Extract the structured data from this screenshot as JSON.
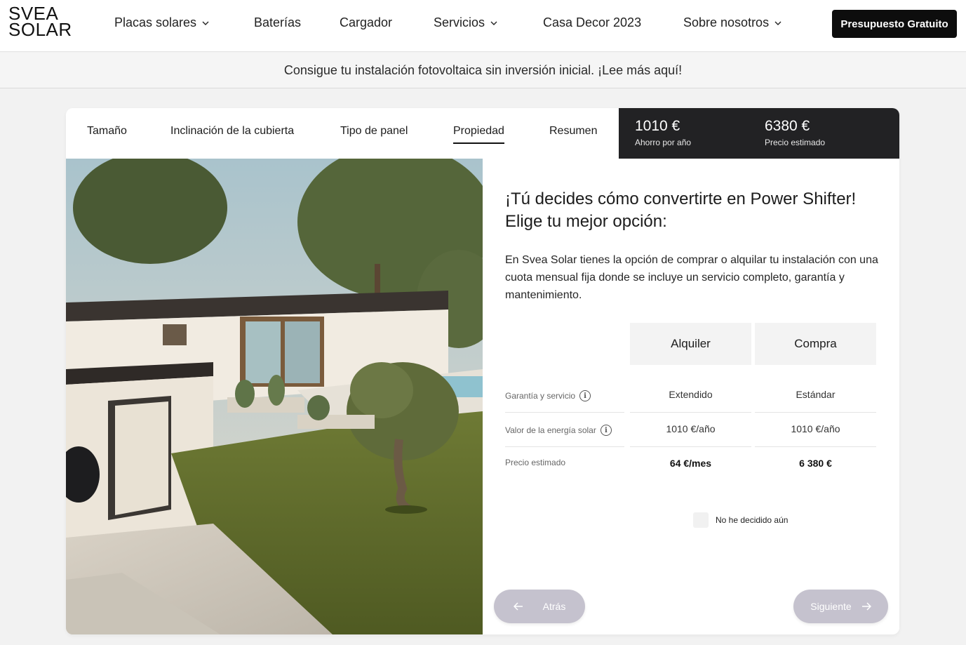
{
  "header": {
    "logo_line1": "SVEA",
    "logo_line2": "SOLAR",
    "nav": [
      {
        "label": "Placas solares",
        "icon": "chevron-down-icon"
      },
      {
        "label": "Baterías"
      },
      {
        "label": "Cargador"
      },
      {
        "label": "Servicios",
        "icon": "chevron-down-icon"
      },
      {
        "label": "Casa Decor 2023"
      },
      {
        "label": "Sobre nosotros",
        "icon": "chevron-down-icon"
      }
    ],
    "cta_label": "Presupuesto Gratuito"
  },
  "banner": {
    "text": "Consigue tu instalación fotovoltaica sin inversión inicial. ¡Lee más aquí!"
  },
  "steps": {
    "tabs": [
      "Tamaño",
      "Inclinación de la cubierta",
      "Tipo de panel",
      "Propiedad",
      "Resumen"
    ],
    "active_tab": "Propiedad"
  },
  "summary": {
    "savings_value": "1010 €",
    "savings_label": "Ahorro por año",
    "price_value": "6380 €",
    "price_label": "Precio estimado"
  },
  "panel": {
    "heading": "¡Tú decides cómo convertirte en Power Shifter! Elige tu mejor opción:",
    "description": "En Svea Solar tienes la opción de comprar o alquilar tu instalación con una cuota mensual fija donde se incluye un servicio completo, garantía y mantenimiento.",
    "options": [
      "Alquiler",
      "Compra"
    ],
    "rows": [
      {
        "label": "Garantía y servicio",
        "info_icon": true,
        "values": [
          "Extendido",
          "Estándar"
        ]
      },
      {
        "label": "Valor de la energía solar",
        "info_icon": true,
        "values": [
          "1010 €/año",
          "1010 €/año"
        ]
      },
      {
        "label": "Precio estimado",
        "info_icon": false,
        "values": [
          "64 €/mes",
          "6 380 €"
        ]
      }
    ],
    "undecided_label": "No he decidido aún",
    "back_label": "Atrás",
    "next_label": "Siguiente"
  },
  "colors": {
    "dark": "#222224",
    "button_disabled": "#c5c2ce",
    "background": "#f2f2f2"
  }
}
